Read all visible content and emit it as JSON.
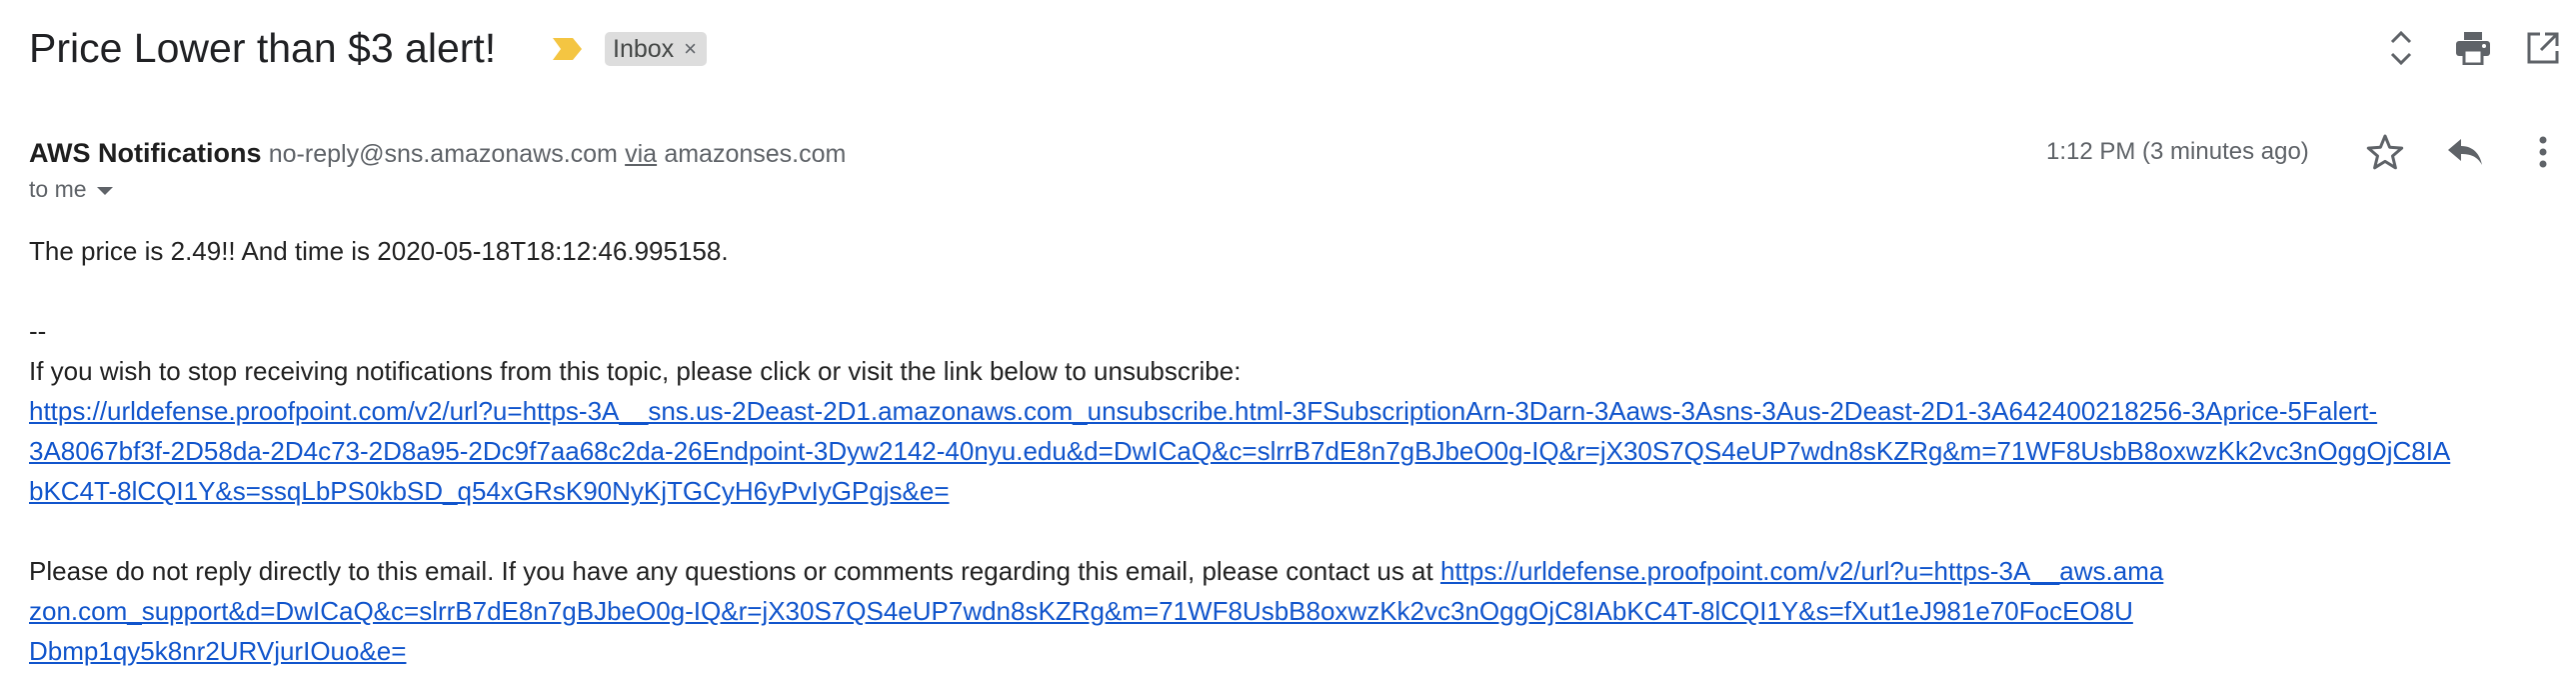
{
  "header": {
    "subject": "Price Lower than $3 alert!",
    "label": "Inbox",
    "label_remove_glyph": "×",
    "icons": [
      "important-marker-icon",
      "expand-collapse-icon",
      "print-icon",
      "open-in-new-window-icon"
    ],
    "colors": {
      "important_marker": "#f4c542",
      "label_chip_bg": "#dddddd"
    }
  },
  "message": {
    "sender_name": "AWS Notifications",
    "sender_email": "no-reply@sns.amazonaws.com",
    "via_label": "via",
    "via_domain": "amazonses.com",
    "recipient": "to me",
    "timestamp": "1:12 PM (3 minutes ago)",
    "action_icons": [
      "star-icon",
      "reply-icon",
      "more-vertical-icon"
    ]
  },
  "body": {
    "line_price": "The price is 2.49!! And time is 2020-05-18T18:12:46.995158.",
    "separator": "--",
    "unsubscribe_intro": "If you wish to stop receiving notifications from this topic, please click or visit the link below to unsubscribe:",
    "unsubscribe_link_lines": [
      "https://urldefense.proofpoint.com/v2/url?u=https-3A__sns.us-2Deast-2D1.amazonaws.com_unsubscribe.html-3FSubscriptionArn-3Darn-3Aaws-3Asns-3Aus-2Deast-2D1-3A642400218256-3Aprice-5Falert-",
      "3A8067bf3f-2D58da-2D4c73-2D8a95-2Dc9f7aa68c2da-26Endpoint-3Dyw2142-40nyu.edu&d=DwICaQ&c=slrrB7dE8n7gBJbeO0g-IQ&r=jX30S7QS4eUP7wdn8sKZRg&m=71WF8UsbB8oxwzKk2vc3nOggOjC8IA",
      "bKC4T-8lCQI1Y&s=ssqLbPS0kbSD_q54xGRsK90NyKjTGCyH6yPvIyGPgjs&e="
    ],
    "contact_text": "Please do not reply directly to this email. If you have any questions or comments regarding this email, please contact us at ",
    "contact_link_lines": [
      "https://urldefense.proofpoint.com/v2/url?u=https-3A__aws.ama",
      "zon.com_support&d=DwICaQ&c=slrrB7dE8n7gBJbeO0g-IQ&r=jX30S7QS4eUP7wdn8sKZRg&m=71WF8UsbB8oxwzKk2vc3nOggOjC8IAbKC4T-8lCQI1Y&s=fXut1eJ981e70FocEO8U",
      "Dbmp1qy5k8nr2URVjurIOuo&e="
    ],
    "link_color": "#1155cc"
  }
}
